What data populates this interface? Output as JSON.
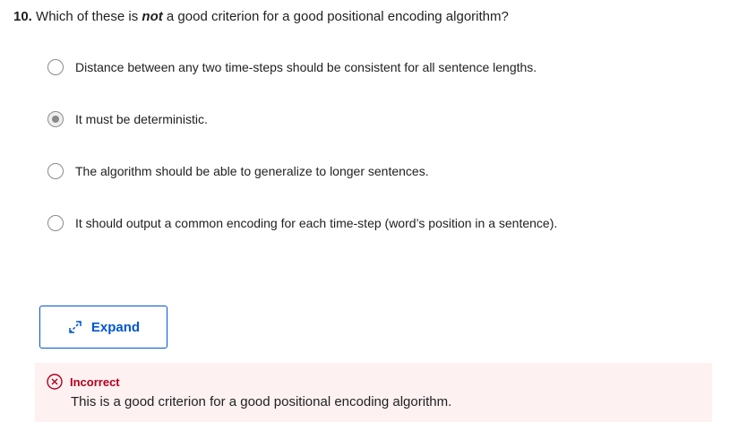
{
  "question": {
    "number": "10.",
    "prefix": "Which of these is",
    "emphasis": "not",
    "suffix": "a good criterion for a good positional encoding algorithm?"
  },
  "options": [
    {
      "label": "Distance between any two time-steps should be consistent for all sentence lengths.",
      "selected": false
    },
    {
      "label": "It must be deterministic.",
      "selected": true
    },
    {
      "label": "The algorithm should be able to generalize to longer sentences.",
      "selected": false
    },
    {
      "label": "It should output a common encoding for each time-step (word’s position in a sentence).",
      "selected": false
    }
  ],
  "expand": {
    "label": "Expand",
    "icon": "expand-arrows-icon"
  },
  "feedback": {
    "status": "Incorrect",
    "icon": "x-circle-icon",
    "message": "This is a good criterion for a good positional encoding algorithm."
  },
  "colors": {
    "accent": "#0056d2",
    "error": "#b3001e",
    "error_bg": "#fdf1f2",
    "text": "#1f1f1f"
  }
}
